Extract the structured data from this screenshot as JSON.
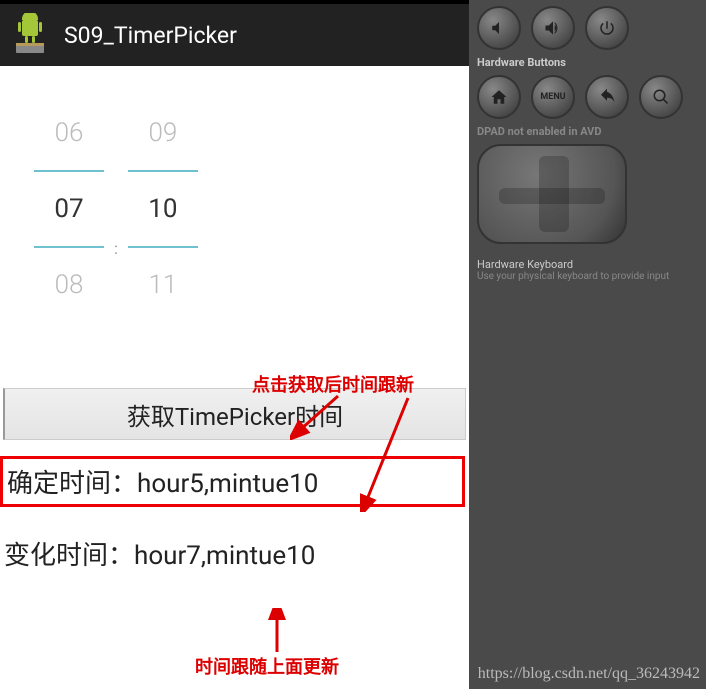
{
  "app": {
    "title": "S09_TimerPicker"
  },
  "picker": {
    "hour_prev": "06",
    "hour_sel": "07",
    "hour_next": "08",
    "min_prev": "09",
    "min_sel": "10",
    "min_next": "11",
    "colon": ":"
  },
  "annot": {
    "click_update": "点击获取后时间跟新",
    "follow_update": "时间跟随上面更新"
  },
  "button": {
    "get_time": "获取TimePicker时间"
  },
  "results": {
    "confirmed": "确定时间：hour5,mintue10",
    "changed": "变化时间：hour7,mintue10"
  },
  "side": {
    "hw_buttons": "Hardware Buttons",
    "dpad": "DPAD not enabled in AVD",
    "kbd_title": "Hardware Keyboard",
    "kbd_sub": "Use your physical keyboard to provide input",
    "menu": "MENU"
  },
  "watermark": "https://blog.csdn.net/qq_36243942"
}
